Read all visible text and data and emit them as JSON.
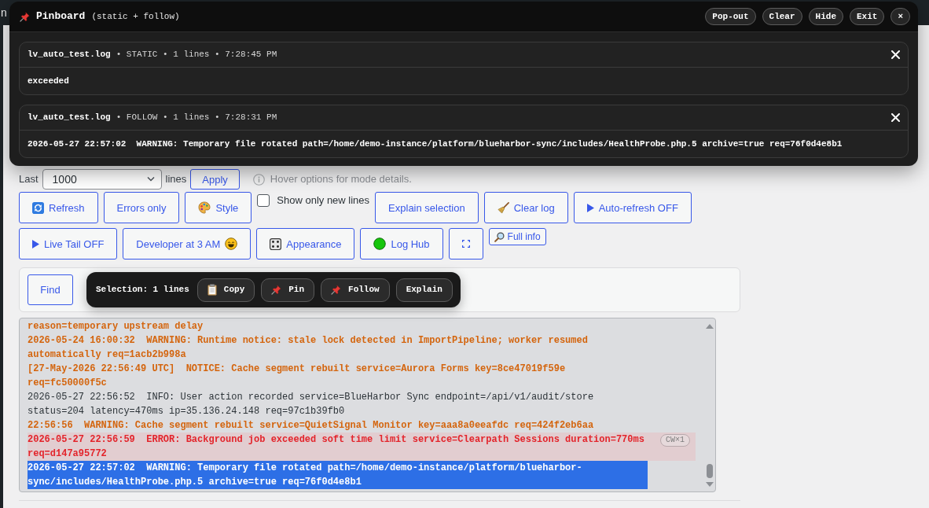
{
  "admin_bar": {
    "text": "n"
  },
  "pinboard": {
    "title": "Pinboard",
    "subtitle": "(static + follow)",
    "buttons": [
      "Pop-out",
      "Clear",
      "Hide",
      "Exit",
      "×"
    ],
    "pins": [
      {
        "file": "lv_auto_test.log",
        "meta": "• STATIC • 1 lines • 7:28:45 PM",
        "text": "exceeded"
      },
      {
        "file": "lv_auto_test.log",
        "meta": "• FOLLOW • 1 lines • 7:28:31 PM",
        "text": "2026-05-27 22:57:02  WARNING: Temporary file rotated path=/home/demo-instance/platform/blueharbor-sync/includes/HealthProbe.php.5 archive=true req=76f0d4e8b1"
      }
    ]
  },
  "range": {
    "label": "Last",
    "value": "1000",
    "unit": "lines",
    "button": "Apply",
    "hint": "Hover options for mode details."
  },
  "action_rows": [
    {
      "items": [
        {
          "kind": "button",
          "label": "Refresh"
        },
        {
          "kind": "button",
          "label": "Errors only"
        },
        {
          "kind": "button",
          "label": "Style"
        },
        {
          "kind": "checkbox",
          "label": "Show only new lines",
          "checked": false
        },
        {
          "kind": "button",
          "label": "Explain selection"
        },
        {
          "kind": "button",
          "label": "Clear log"
        },
        {
          "kind": "button",
          "label": "Auto-refresh OFF"
        }
      ]
    },
    {
      "items": [
        {
          "kind": "button",
          "label": "Live Tail OFF"
        },
        {
          "kind": "button",
          "label": "Developer at 3 AM"
        },
        {
          "kind": "button",
          "label": "Appearance"
        },
        {
          "kind": "button",
          "label": "Log Hub"
        },
        {
          "kind": "icon_button"
        },
        {
          "kind": "small_button",
          "label": "Full info"
        }
      ]
    }
  ],
  "find_panel": {
    "button": "Find"
  },
  "selection_toolbar": {
    "label": "Selection: 1 lines",
    "buttons": [
      "Copy",
      "Pin",
      "Follow",
      "Explain"
    ]
  },
  "log": {
    "entries": [
      {
        "kind": "warning",
        "text": "reason=temporary upstream delay",
        "selected": false
      },
      {
        "kind": "warning",
        "text": "2026-05-24 16:00:32  WARNING: Runtime notice: stale lock detected in ImportPipeline; worker resumed automatically req=1acb2b998a",
        "selected": false
      },
      {
        "kind": "notice",
        "text": "[27-May-2026 22:56:49 UTC]  NOTICE: Cache segment rebuilt service=Aurora Forms key=8ce47019f59e req=fc50000f5c",
        "selected": false
      },
      {
        "kind": "info",
        "text": "2026-05-27 22:56:52  INFO: User action recorded service=BlueHarbor Sync endpoint=/api/v1/audit/store status=204 latency=470ms ip=35.136.24.148 req=97c1b39fb0",
        "selected": false
      },
      {
        "kind": "warning",
        "text": "22:56:56  WARNING: Cache segment rebuilt service=QuietSignal Monitor key=aaa8a0eeafdc req=424f2eb6aa",
        "selected": false
      },
      {
        "kind": "error",
        "text": "2026-05-27 22:56:59  ERROR: Background job exceeded soft time limit service=Clearpath Sessions duration=770ms req=d147a95772",
        "badge": "CW×1",
        "selected": false
      },
      {
        "kind": "warning",
        "text": "2026-05-27 22:57:02  WARNING: Temporary file rotated path=/home/demo-instance/platform/blueharbor-sync/includes/HealthProbe.php.5 archive=true req=76f0d4e8b1",
        "selected": true
      }
    ]
  }
}
